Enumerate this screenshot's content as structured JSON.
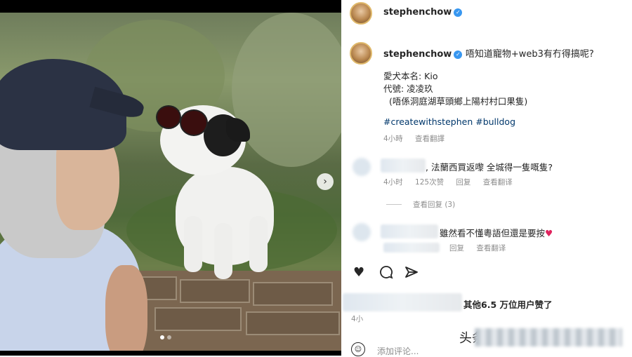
{
  "post": {
    "username": "stephenchow",
    "caption_user": "stephenchow",
    "caption_title": "唔知道寵物+web3有冇得搞呢?",
    "caption_lines": [
      "愛犬本名: Kio",
      "代號: 凌凌玖",
      "(唔係洞庭湖草頭鄉上陽村村口果隻)"
    ],
    "hashtags": "#createwithstephen #bulldog",
    "caption_time": "4小時",
    "caption_translate": "查看翻譯"
  },
  "comments": [
    {
      "text": ", 法蘭西買返嚟 全城得一隻嘅隻?",
      "time": "4小时",
      "likes": "125次赞",
      "reply": "回复",
      "translate": "查看翻译",
      "view_replies": "查看回复 (3)"
    },
    {
      "text": "雖然看不懂粵語但還是要按",
      "reply": "回复",
      "translate": "查看翻译"
    }
  ],
  "likes_summary": "其他6.5 万位用户赞了",
  "likes_time": "4小",
  "comment_placeholder": "添加评论...",
  "watermark": "头条",
  "icons": {
    "verified": "verified-badge-icon",
    "next": "chevron-right-icon",
    "comment": "comment-icon",
    "share": "share-icon",
    "like": "heart-icon",
    "emoji": "emoji-icon"
  },
  "colors": {
    "link": "#00376b",
    "verified": "#3897f0",
    "heart": "#e0245e",
    "meta": "#8e8e8e"
  }
}
